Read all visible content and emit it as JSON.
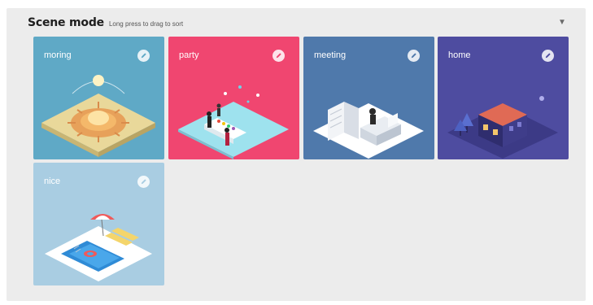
{
  "header": {
    "title": "Scene mode",
    "hint": "Long press to drag to sort",
    "collapse_icon": "chevron-down-icon"
  },
  "scenes": [
    {
      "label": "moring",
      "bg": "#5fa9c6",
      "icon": "edit-icon"
    },
    {
      "label": "party",
      "bg": "#f04670",
      "icon": "edit-icon"
    },
    {
      "label": "meeting",
      "bg": "#4f79ab",
      "icon": "edit-icon"
    },
    {
      "label": "home",
      "bg": "#4e4ca0",
      "icon": "edit-icon"
    },
    {
      "label": "nice",
      "bg": "#a9cde2",
      "icon": "edit-icon"
    }
  ]
}
